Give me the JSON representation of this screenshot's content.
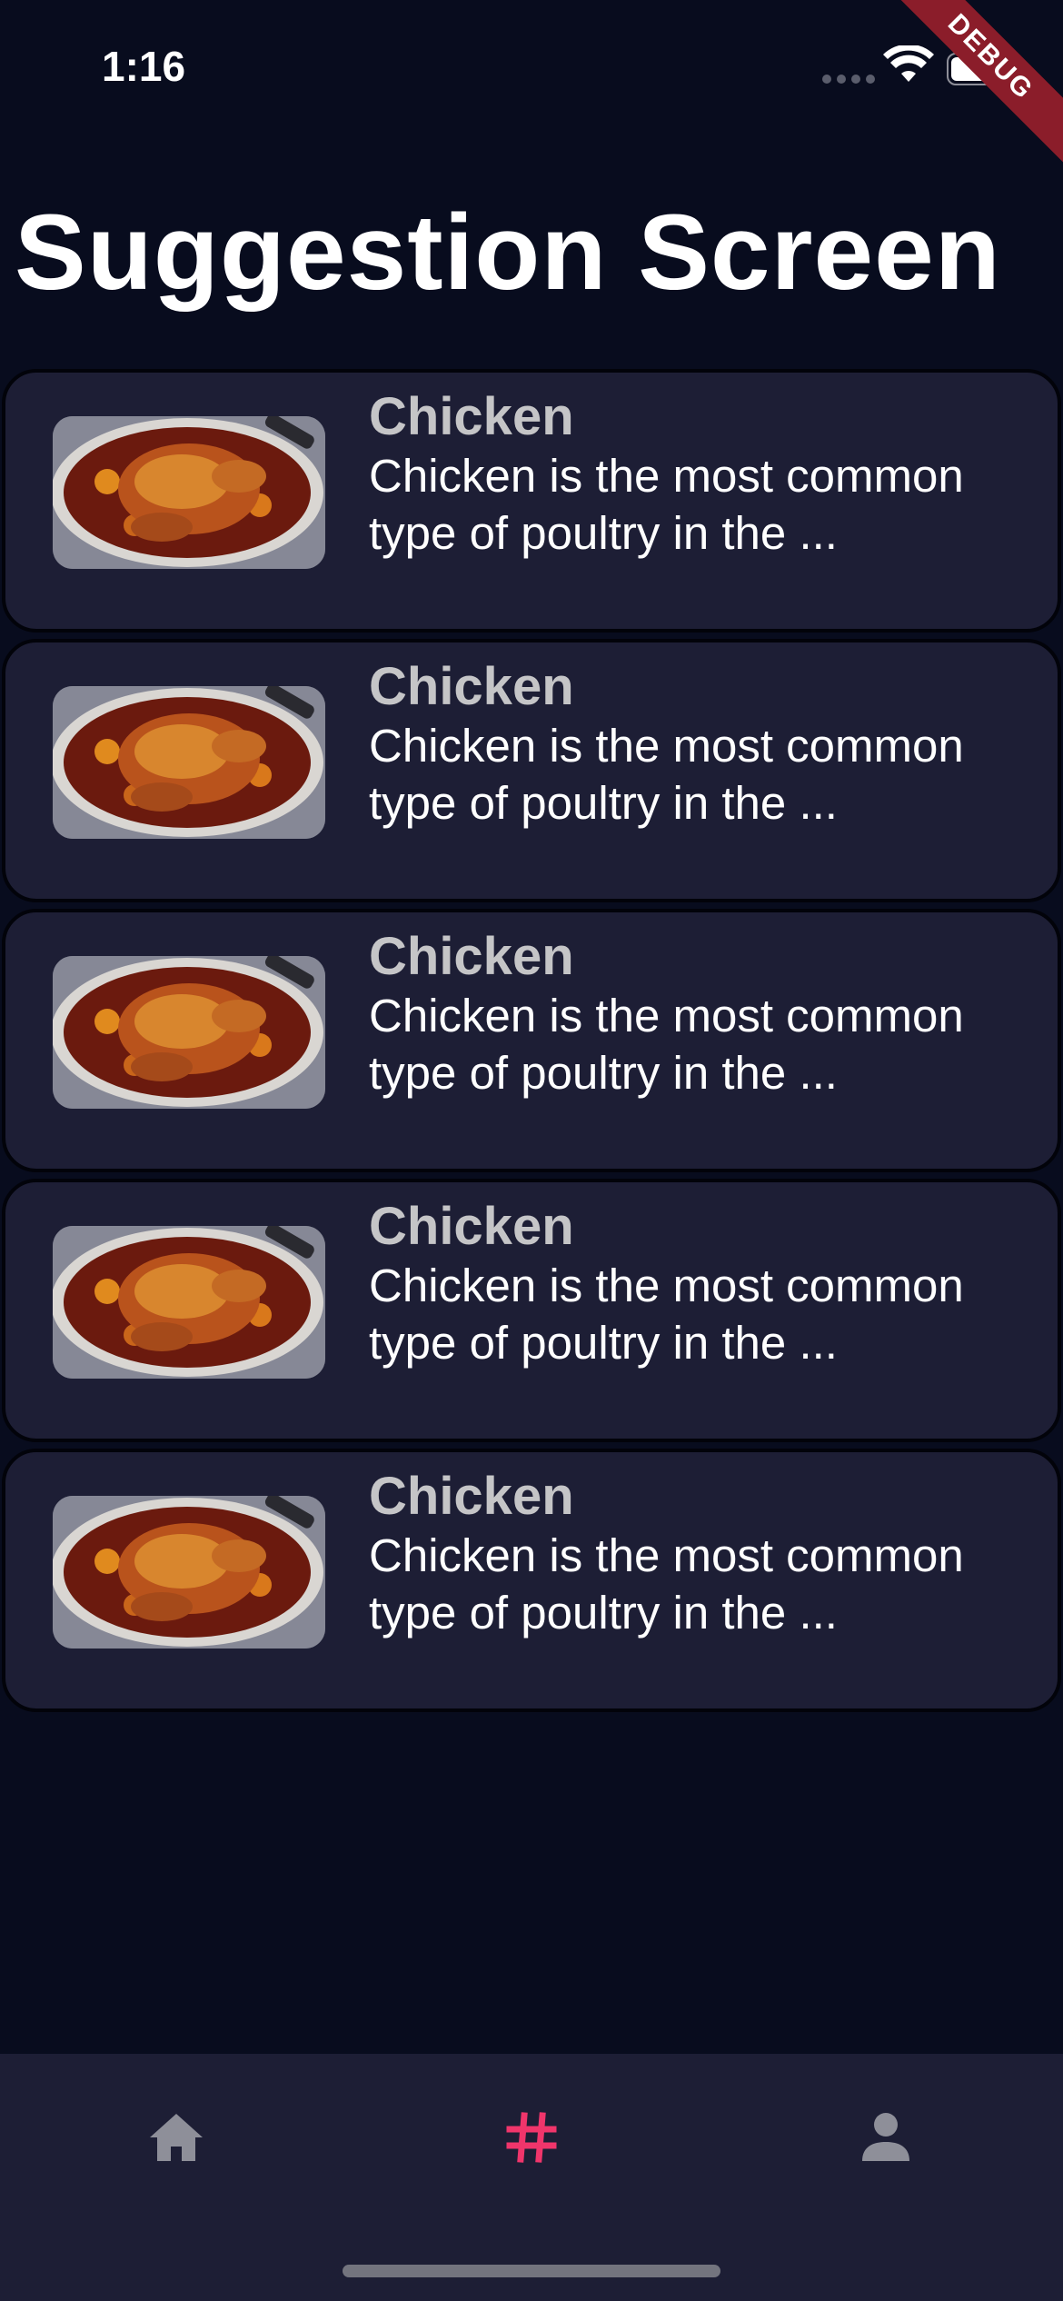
{
  "status_bar": {
    "time": "1:16"
  },
  "debug_banner": {
    "label": "DEBUG"
  },
  "page": {
    "title": "Suggestion Screen"
  },
  "suggestions": [
    {
      "title": "Chicken",
      "description": "Chicken is the most common type of poultry in the ...",
      "image": "roast-chicken-photo"
    },
    {
      "title": "Chicken",
      "description": "Chicken is the most common type of poultry in the ...",
      "image": "roast-chicken-photo"
    },
    {
      "title": "Chicken",
      "description": "Chicken is the most common type of poultry in the ...",
      "image": "roast-chicken-photo"
    },
    {
      "title": "Chicken",
      "description": "Chicken is the most common type of poultry in the ...",
      "image": "roast-chicken-photo"
    },
    {
      "title": "Chicken",
      "description": "Chicken is the most common type of poultry in the ...",
      "image": "roast-chicken-photo"
    }
  ],
  "bottom_nav": {
    "items": [
      {
        "icon": "home-icon",
        "active": false
      },
      {
        "icon": "hashtag-icon",
        "active": true
      },
      {
        "icon": "person-icon",
        "active": false
      }
    ],
    "active_color": "#f0356b",
    "inactive_color": "#8e8f99"
  },
  "colors": {
    "background": "#080c1e",
    "card": "#1d1e35",
    "nav_bar": "#1d1e35",
    "debug_ribbon": "#8b1d2a"
  }
}
